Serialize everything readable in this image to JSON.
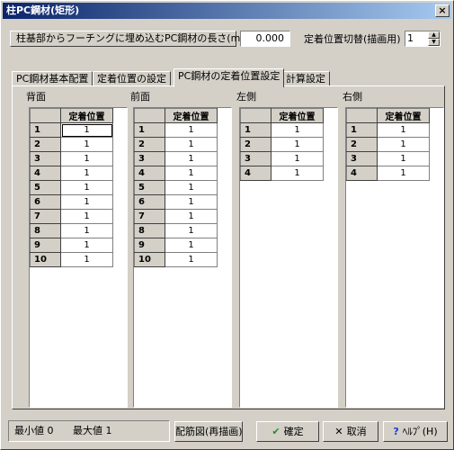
{
  "window": {
    "title": "柱PC鋼材(矩形)",
    "close_glyph": "×"
  },
  "length": {
    "label": "柱基部からフーチングに埋め込むPC鋼材の長さ(m)",
    "value": "0.000"
  },
  "position_switch": {
    "label": "定着位置切替(描画用)",
    "value": "1"
  },
  "tabs": [
    {
      "label": "PC鋼材基本配置"
    },
    {
      "label": "定着位置の設定"
    },
    {
      "label": "PC鋼材の定着位置設定",
      "active": true
    },
    {
      "label": "計算設定"
    }
  ],
  "grids": [
    {
      "label": "背面",
      "header": "定着位置",
      "rows": [
        [
          "1",
          "1"
        ],
        [
          "2",
          "1"
        ],
        [
          "3",
          "1"
        ],
        [
          "4",
          "1"
        ],
        [
          "5",
          "1"
        ],
        [
          "6",
          "1"
        ],
        [
          "7",
          "1"
        ],
        [
          "8",
          "1"
        ],
        [
          "9",
          "1"
        ],
        [
          "10",
          "1"
        ]
      ]
    },
    {
      "label": "前面",
      "header": "定着位置",
      "rows": [
        [
          "1",
          "1"
        ],
        [
          "2",
          "1"
        ],
        [
          "3",
          "1"
        ],
        [
          "4",
          "1"
        ],
        [
          "5",
          "1"
        ],
        [
          "6",
          "1"
        ],
        [
          "7",
          "1"
        ],
        [
          "8",
          "1"
        ],
        [
          "9",
          "1"
        ],
        [
          "10",
          "1"
        ]
      ]
    },
    {
      "label": "左側",
      "header": "定着位置",
      "rows": [
        [
          "1",
          "1"
        ],
        [
          "2",
          "1"
        ],
        [
          "3",
          "1"
        ],
        [
          "4",
          "1"
        ]
      ]
    },
    {
      "label": "右側",
      "header": "定着位置",
      "rows": [
        [
          "1",
          "1"
        ],
        [
          "2",
          "1"
        ],
        [
          "3",
          "1"
        ],
        [
          "4",
          "1"
        ]
      ]
    }
  ],
  "status": {
    "min": "最小値 0",
    "max": "最大値 1"
  },
  "buttons": {
    "redraw": "配筋図(再描画)",
    "ok": "確定",
    "cancel": "取消",
    "help": "ﾍﾙﾌﾟ(H)"
  },
  "colors": {
    "ok_check": "#2a8a2a",
    "cancel_x": "#000000",
    "help_q": "#1a3ec8"
  },
  "icons": {
    "ok": "check-icon",
    "cancel": "x-icon",
    "help": "question-icon"
  }
}
